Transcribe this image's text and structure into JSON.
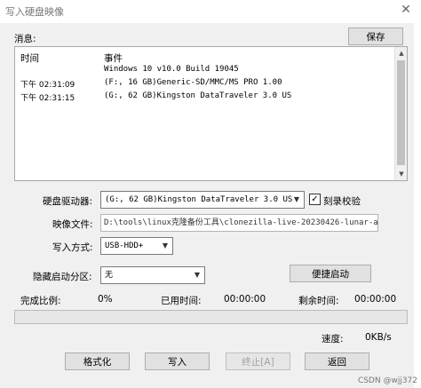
{
  "window": {
    "title": "写入硬盘映像",
    "close_glyph": "✕"
  },
  "messages": {
    "label": "消息:",
    "save_button": "保存",
    "columns": {
      "time": "时间",
      "event": "事件"
    },
    "rows": [
      {
        "time": "",
        "event": "Windows 10 v10.0 Build 19045"
      },
      {
        "time": "下午 02:31:09",
        "event": "(F:, 16 GB)Generic-SD/MMC/MS PRO    1.00"
      },
      {
        "time": "下午 02:31:15",
        "event": "(G:, 62 GB)Kingston DataTraveler 3.0 US"
      }
    ]
  },
  "form": {
    "drive_label": "硬盘驱动器:",
    "drive_value": "(G:, 62 GB)Kingston DataTraveler 3.0 US",
    "verify_label": "刻录校验",
    "verify_checked": true,
    "image_label": "映像文件:",
    "image_value": "D:\\tools\\linux克隆备份工具\\clonezilla-live-20230426-lunar-a",
    "write_mode_label": "写入方式:",
    "write_mode_value": "USB-HDD+",
    "hidden_partition_label": "隐藏启动分区:",
    "hidden_partition_value": "无",
    "quick_boot_button": "便捷启动"
  },
  "status": {
    "complete_label": "完成比例:",
    "complete_value": "0%",
    "elapsed_label": "已用时间:",
    "elapsed_value": "00:00:00",
    "remaining_label": "剩余时间:",
    "remaining_value": "00:00:00",
    "progress_fraction": 0,
    "speed_label": "速度:",
    "speed_value": "0KB/s"
  },
  "actions": {
    "format": "格式化",
    "write": "写入",
    "abort": "终止[A]",
    "back": "返回"
  },
  "watermark": "CSDN @wjj372"
}
